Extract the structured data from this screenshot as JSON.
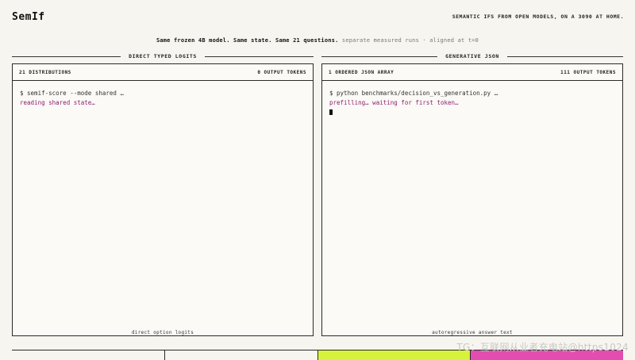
{
  "header": {
    "brand": "SemIf",
    "tagline": "SEMANTIC IFS FROM OPEN MODELS, ON A 3090 AT HOME."
  },
  "subtitle": {
    "part1": "Same frozen 4B model. Same state. Same 21 questions.",
    "part2": " separate measured runs · aligned at t=0"
  },
  "left": {
    "section_title": "DIRECT TYPED LOGITS",
    "bar_left": "21 DISTRIBUTIONS",
    "bar_right": "0 OUTPUT TOKENS",
    "command": "$ semif-score --mode shared …",
    "status": "reading shared state…",
    "footer": "direct option logits"
  },
  "right": {
    "section_title": "GENERATIVE JSON",
    "bar_left": "1 ORDERED JSON ARRAY",
    "bar_right": "111 OUTPUT TOKENS",
    "command": "$ python benchmarks/decision_vs_generation.py …",
    "status": "prefilling… waiting for first token…",
    "footer": "autoregressive answer text"
  },
  "watermark": "TG：互联网从业者充电站@https1024",
  "colors": {
    "background": "#f7f5ef",
    "status_text": "#8b1e6e",
    "accent_lime": "#d7f23a",
    "accent_pink": "#e34db0"
  }
}
